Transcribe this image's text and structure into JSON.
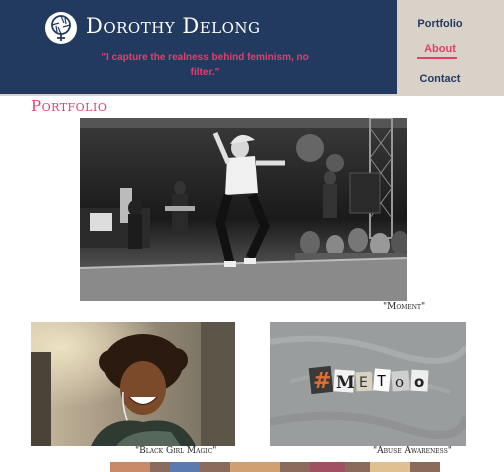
{
  "header": {
    "logo_icon": "camera-aperture-female-icon",
    "site_name": "Dorothy Delong",
    "tagline": "\"I capture the realness behind feminism, no filter.\""
  },
  "nav": {
    "items": [
      {
        "label": "Portfolio",
        "active": false
      },
      {
        "label": "About",
        "active": true
      },
      {
        "label": "Contact",
        "active": false
      }
    ]
  },
  "section": {
    "title": "Portfolio"
  },
  "gallery": [
    {
      "caption": "\"Moment\""
    },
    {
      "caption": "\"Black Girl Magic\""
    },
    {
      "caption": "\"Abuse Awareness\""
    }
  ],
  "colors": {
    "header_bg": "#233a60",
    "nav_bg": "#d8d2c8",
    "accent": "#e23f6a"
  }
}
